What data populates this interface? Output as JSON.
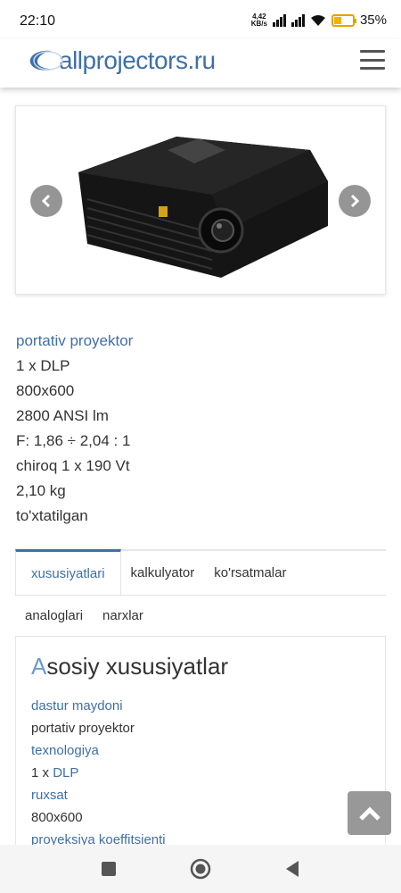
{
  "status_bar": {
    "time": "22:10",
    "net_speed_value": "4,42",
    "net_speed_unit": "KB/s",
    "battery_percent": "35%",
    "battery_level": 0.35
  },
  "header": {
    "logo_text": "allprojectors.ru",
    "brand_color": "#3f6fa8"
  },
  "product": {
    "image_icon": "projector-image",
    "specs": [
      "portativ proyektor",
      "1 x DLP",
      "800x600",
      "2800 ANSI lm",
      "F: 1,86 ÷ 2,04 : 1",
      "chiroq 1 x 190 Vt",
      "2,10 kg",
      "to'xtatilgan"
    ]
  },
  "tabs": {
    "items": [
      "xususiyatlari",
      "kalkulyator",
      "ko'rsatmalar",
      "analoglari",
      "narxlar"
    ],
    "active_index": 0
  },
  "panel": {
    "title_first_letter": "A",
    "title_rest": "sosiy xususiyatlar",
    "rows": [
      {
        "label": "dastur maydoni",
        "value": "portativ proyektor"
      },
      {
        "label": "texnologiya",
        "value_prefix": "1 x ",
        "value_link": "DLP"
      },
      {
        "label": "ruxsat",
        "value": "800x600"
      },
      {
        "label": "proyeksiya koeffitsienti"
      }
    ]
  }
}
